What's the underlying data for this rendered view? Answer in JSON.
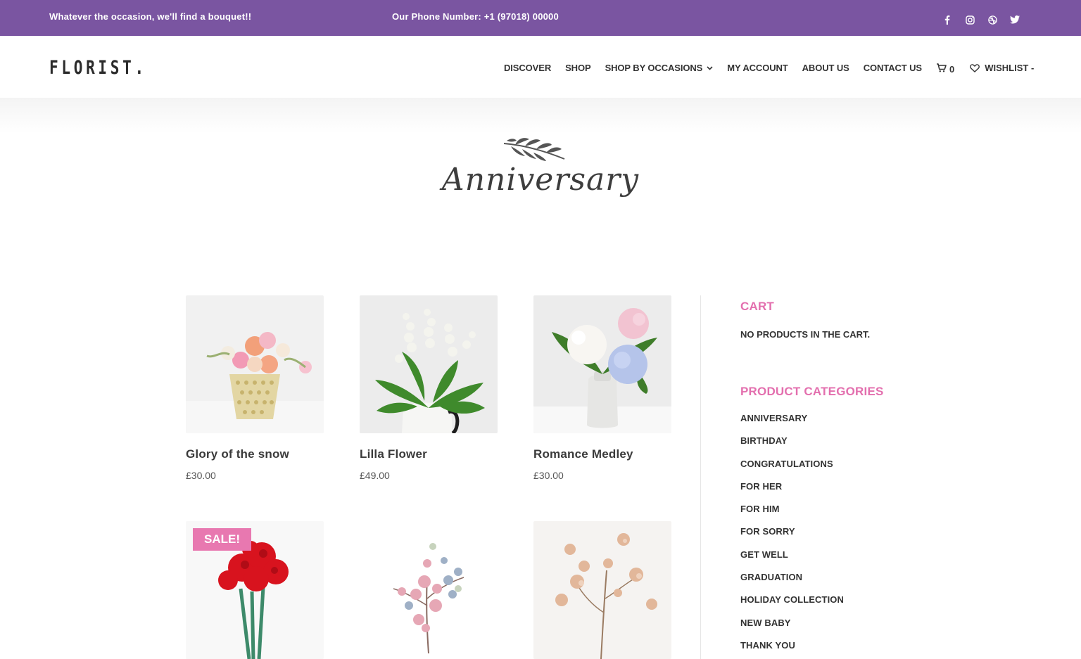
{
  "topbar": {
    "tagline": "Whatever the occasion, we'll find a bouquet!!",
    "phone": "Our Phone  Number:  +1 (97018) 00000",
    "social_icons": [
      "facebook-icon",
      "instagram-icon",
      "dribbble-icon",
      "twitter-icon"
    ]
  },
  "header": {
    "logo": "FLORIST.",
    "nav": {
      "discover": "DISCOVER",
      "shop": "SHOP",
      "occasions": "SHOP BY OCCASIONS",
      "account": "MY ACCOUNT",
      "about": "ABOUT US",
      "contact": "CONTACT US",
      "cart_count": "0",
      "wishlist": "WISHLIST -"
    }
  },
  "hero": {
    "title": "Anniversary"
  },
  "products": [
    {
      "name": "Glory of the snow",
      "price": "£30.00"
    },
    {
      "name": "Lilla Flower",
      "price": "£49.00"
    },
    {
      "name": "Romance Medley",
      "price": "£30.00"
    },
    {
      "name": "",
      "price": "",
      "badge": "SALE!"
    },
    {
      "name": "",
      "price": ""
    },
    {
      "name": "",
      "price": ""
    }
  ],
  "sidebar": {
    "cart_title": "CART",
    "cart_empty": "NO PRODUCTS IN THE CART.",
    "categories_title": "PRODUCT CATEGORIES",
    "categories": [
      "ANNIVERSARY",
      "BIRTHDAY",
      "CONGRATULATIONS",
      "FOR HER",
      "FOR HIM",
      "FOR SORRY",
      "GET WELL",
      "GRADUATION",
      "HOLIDAY COLLECTION",
      "NEW BABY",
      "THANK YOU"
    ]
  },
  "colors": {
    "topbar_bg": "#7a55a1",
    "accent_pink": "#e36fae",
    "sale_badge": "#e878b0"
  }
}
